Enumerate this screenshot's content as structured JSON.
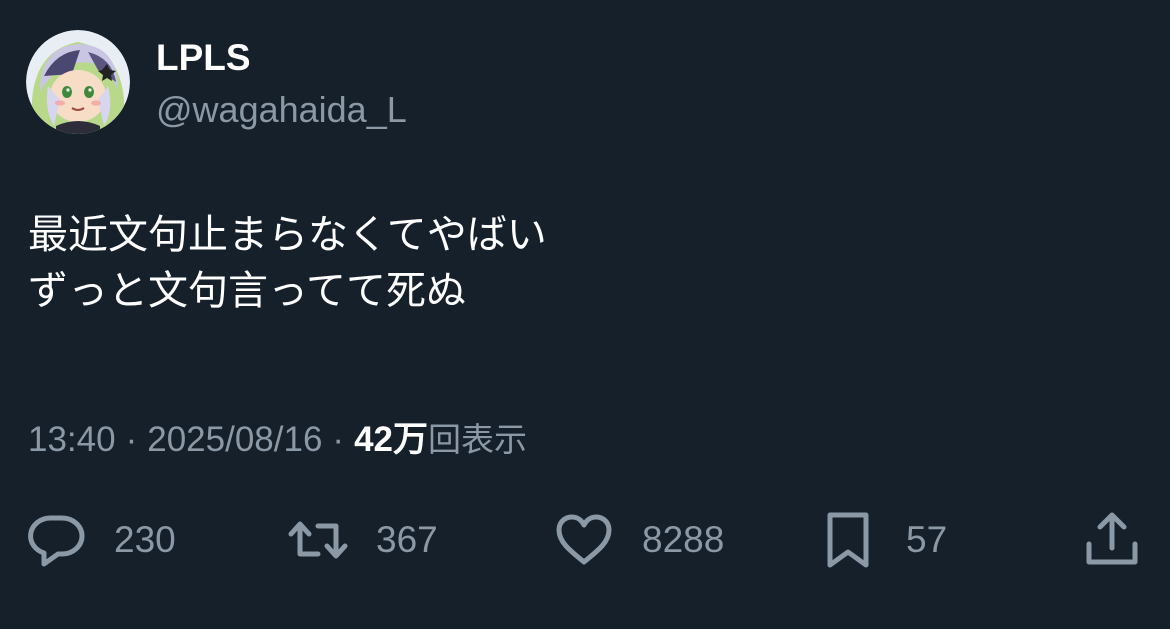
{
  "user": {
    "display_name": "LPLS",
    "handle": "@wagahaida_L",
    "avatar_icon": "anime-character-avatar"
  },
  "tweet": {
    "text_lines": [
      "最近文句止まらなくてやばい",
      "ずっと文句言ってて死ぬ"
    ]
  },
  "meta": {
    "time": "13:40",
    "separator": "·",
    "date": "2025/08/16",
    "views_count": "42万",
    "views_suffix": "回表示"
  },
  "actions": {
    "reply": {
      "icon": "reply-icon",
      "count": "230"
    },
    "retweet": {
      "icon": "retweet-icon",
      "count": "367"
    },
    "like": {
      "icon": "heart-icon",
      "count": "8288"
    },
    "bookmark": {
      "icon": "bookmark-icon",
      "count": "57"
    },
    "share": {
      "icon": "share-icon"
    }
  },
  "colors": {
    "background": "#15202b",
    "primary_text": "#ffffff",
    "secondary_text": "#8b98a5"
  }
}
